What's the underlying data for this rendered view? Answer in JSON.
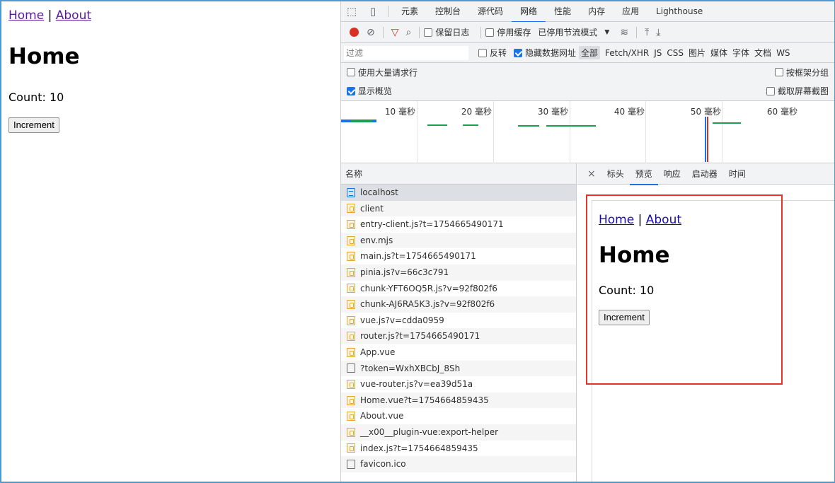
{
  "page": {
    "nav_home": "Home",
    "nav_sep": "|",
    "nav_about": "About",
    "heading": "Home",
    "count_text": "Count: 10",
    "increment_label": "Increment"
  },
  "devtools": {
    "main_tabs": [
      "元素",
      "控制台",
      "源代码",
      "网络",
      "性能",
      "内存",
      "应用",
      "Lighthouse"
    ],
    "active_tab_index": 3,
    "toolbar": {
      "preserve_log": "保留日志",
      "disable_cache": "停用缓存",
      "throttling": "已停用节流模式"
    },
    "filter_bar": {
      "filter_placeholder": "过滤",
      "invert": "反转",
      "hide_data_urls": "隐藏数据网址",
      "types": [
        "全部",
        "Fetch/XHR",
        "JS",
        "CSS",
        "图片",
        "媒体",
        "字体",
        "文档",
        "WS"
      ]
    },
    "options": {
      "large_rows": "使用大量请求行",
      "group_by_frame": "按框架分组",
      "show_overview": "显示概览",
      "capture_screenshots": "截取屏幕截图"
    },
    "timeline_labels": [
      "10 毫秒",
      "20 毫秒",
      "30 毫秒",
      "40 毫秒",
      "50 毫秒",
      "60 毫秒"
    ],
    "list_header": "名称",
    "requests": [
      {
        "name": "localhost",
        "type": "doc"
      },
      {
        "name": "client",
        "type": "js"
      },
      {
        "name": "entry-client.js?t=1754665490171",
        "type": "js"
      },
      {
        "name": "env.mjs",
        "type": "js"
      },
      {
        "name": "main.js?t=1754665490171",
        "type": "js"
      },
      {
        "name": "pinia.js?v=66c3c791",
        "type": "js"
      },
      {
        "name": "chunk-YFT6OQ5R.js?v=92f802f6",
        "type": "js"
      },
      {
        "name": "chunk-AJ6RA5K3.js?v=92f802f6",
        "type": "js"
      },
      {
        "name": "vue.js?v=cdda0959",
        "type": "js"
      },
      {
        "name": "router.js?t=1754665490171",
        "type": "js"
      },
      {
        "name": "App.vue",
        "type": "js"
      },
      {
        "name": "?token=WxhXBCbJ_8Sh",
        "type": "other"
      },
      {
        "name": "vue-router.js?v=ea39d51a",
        "type": "js"
      },
      {
        "name": "Home.vue?t=1754664859435",
        "type": "js"
      },
      {
        "name": "About.vue",
        "type": "js"
      },
      {
        "name": "__x00__plugin-vue:export-helper",
        "type": "js"
      },
      {
        "name": "index.js?t=1754664859435",
        "type": "js"
      },
      {
        "name": "favicon.ico",
        "type": "other"
      }
    ],
    "detail_tabs": [
      "标头",
      "预览",
      "响应",
      "启动器",
      "时间"
    ],
    "active_detail_tab_index": 1,
    "close_glyph": "×",
    "preview": {
      "nav_home": "Home",
      "nav_sep": "|",
      "nav_about": "About",
      "heading": "Home",
      "count_text": "Count: 10",
      "increment_label": "Increment"
    }
  }
}
